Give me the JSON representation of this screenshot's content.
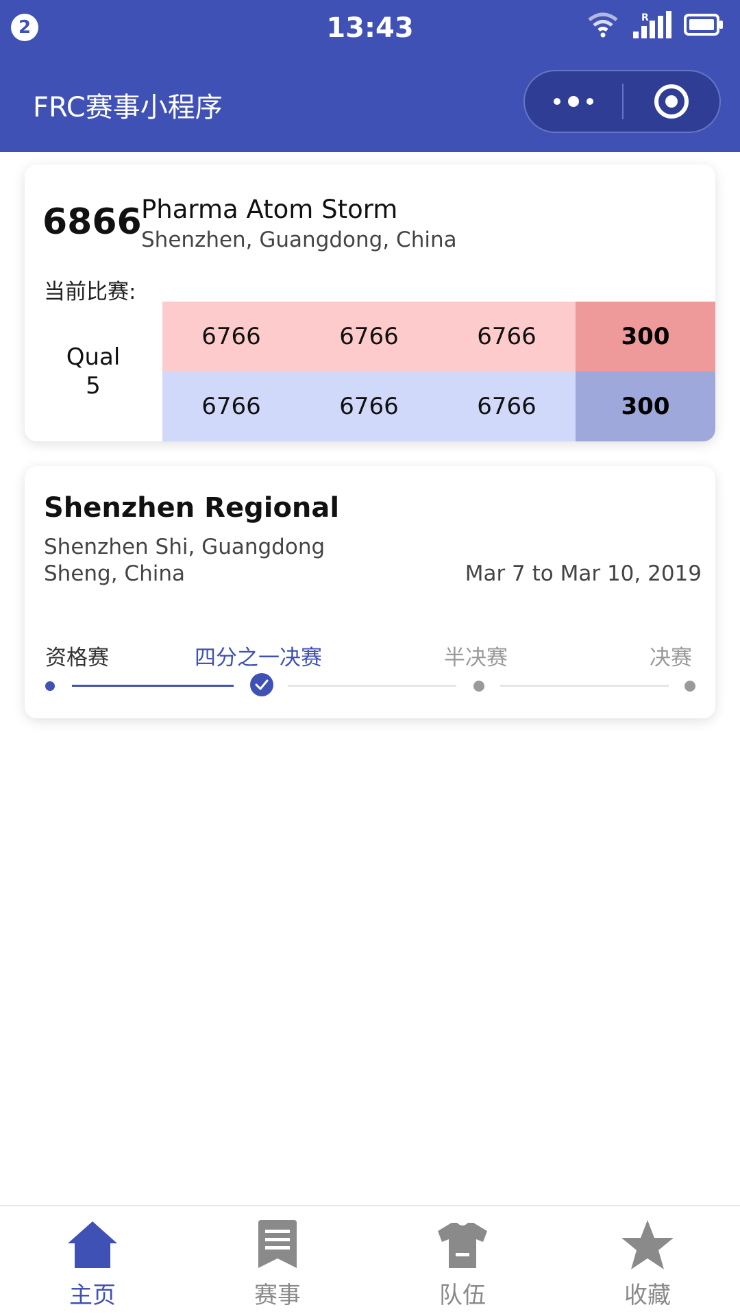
{
  "status_bar": {
    "notification_count": "2",
    "time": "13:43",
    "signal_label": "R"
  },
  "header": {
    "title": "FRC赛事小程序"
  },
  "team": {
    "number": "6866",
    "name": "Pharma Atom Storm",
    "location": "Shenzhen, Guangdong, China",
    "current_match_label": "当前比赛:"
  },
  "match": {
    "type": "Qual",
    "number": "5",
    "red_alliance": [
      "6766",
      "6766",
      "6766"
    ],
    "red_score": "300",
    "blue_alliance": [
      "6766",
      "6766",
      "6766"
    ],
    "blue_score": "300"
  },
  "event": {
    "name": "Shenzhen Regional",
    "location_line1": "Shenzhen Shi, Guangdong",
    "location_line2": "Sheng, China",
    "dates": "Mar 7 to Mar 10, 2019",
    "stages": [
      {
        "label": "资格赛",
        "state": "completed"
      },
      {
        "label": "四分之一决赛",
        "state": "current"
      },
      {
        "label": "半决赛",
        "state": "upcoming"
      },
      {
        "label": "决赛",
        "state": "upcoming"
      }
    ]
  },
  "tabbar": {
    "items": [
      {
        "label": "主页",
        "icon": "home-icon",
        "active": true
      },
      {
        "label": "赛事",
        "icon": "event-icon",
        "active": false
      },
      {
        "label": "队伍",
        "icon": "team-shirt-icon",
        "active": false
      },
      {
        "label": "收藏",
        "icon": "star-icon",
        "active": false
      }
    ]
  },
  "colors": {
    "primary": "#3f51b5",
    "red_alliance": "#fdcbcb",
    "red_score": "#ef9a9a",
    "blue_alliance": "#d1d9fb",
    "blue_score": "#9fa8da",
    "inactive": "#8a8a8a"
  }
}
